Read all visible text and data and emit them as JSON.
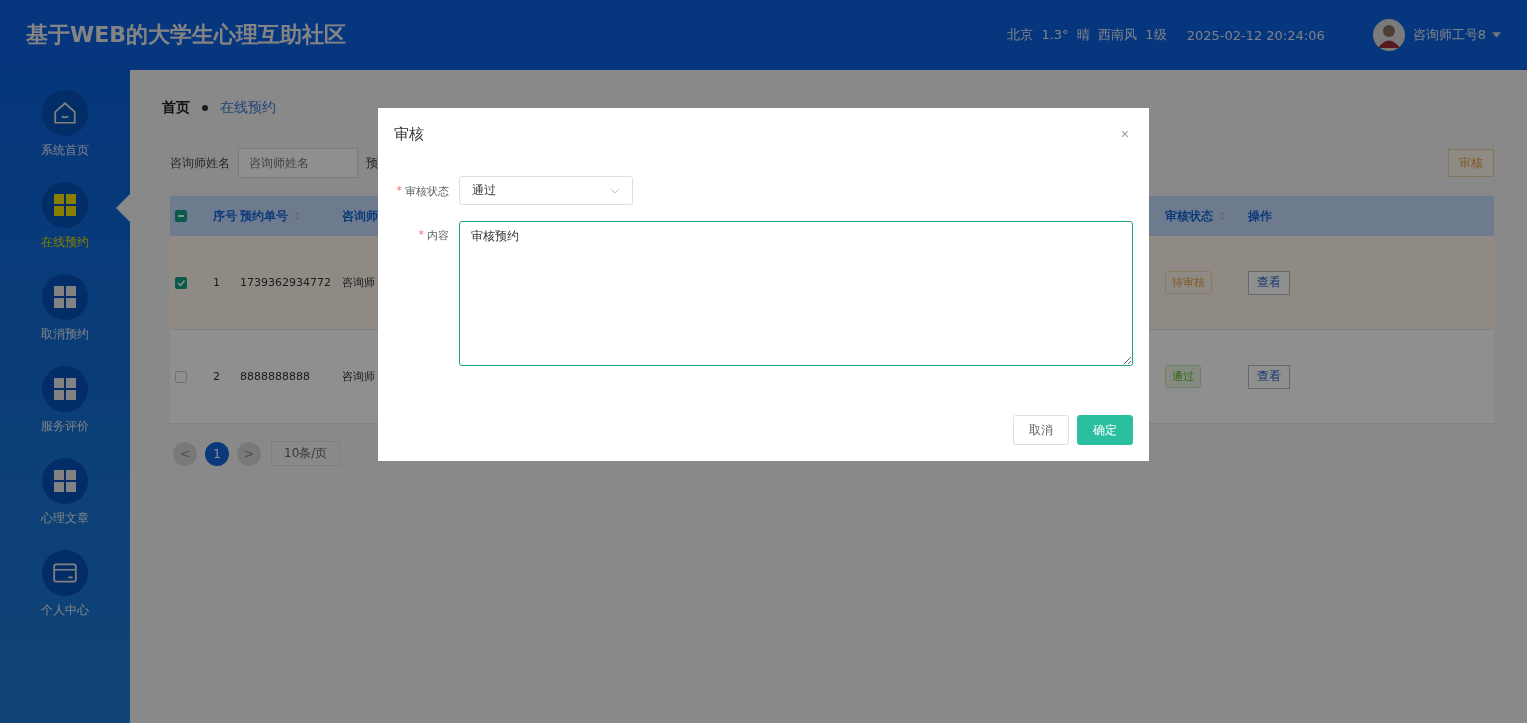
{
  "header": {
    "title": "基于WEB的大学生心理互助社区",
    "weather": "北京  1.3°  晴  西南风  1级",
    "datetime": "2025-02-12 20:24:06",
    "user": "咨询师工号8"
  },
  "sidebar": {
    "items": [
      {
        "label": "系统首页",
        "kind": "home",
        "selected": false
      },
      {
        "label": "在线预约",
        "kind": "grid",
        "selected": true
      },
      {
        "label": "取消预约",
        "kind": "grid",
        "selected": false
      },
      {
        "label": "服务评价",
        "kind": "grid",
        "selected": false
      },
      {
        "label": "心理文章",
        "kind": "grid",
        "selected": false
      },
      {
        "label": "个人中心",
        "kind": "card",
        "selected": false
      }
    ]
  },
  "breadcrumb": [
    {
      "label": "首页",
      "kind": "root"
    },
    {
      "label": "在线预约",
      "kind": "current"
    }
  ],
  "search": {
    "label": "咨询师姓名",
    "placeholder": "咨询师姓名",
    "label_2": "预"
  },
  "actions": [
    {
      "label": "审核"
    }
  ],
  "table": {
    "select_all": {
      "indeterminate": true
    },
    "columns": [
      {
        "label": "序号",
        "sortable": false
      },
      {
        "label": "预约单号",
        "sortable": true
      },
      {
        "label": "咨询师",
        "sortable": false
      },
      {
        "label": "审核状态",
        "sortable": true
      },
      {
        "label": "操作",
        "sortable": false
      }
    ],
    "rows": [
      {
        "checked": true,
        "index": "1",
        "number": "1739362934772",
        "consultant": "咨询师",
        "status": "待审核",
        "kind": "pending",
        "action": "查看"
      },
      {
        "checked": false,
        "index": "2",
        "number": "8888888888",
        "consultant": "咨询师",
        "status": "通过",
        "kind": "passed",
        "action": "查看"
      }
    ]
  },
  "pagination": {
    "prev": "<",
    "pages": [
      {
        "label": "1",
        "selected": true
      }
    ],
    "next": ">",
    "page_size": "10条/页"
  },
  "dialog": {
    "title": "审核",
    "close": "×",
    "fields": [
      {
        "kind": "select",
        "label": "审核状态",
        "required_mark": "*",
        "value": "通过"
      },
      {
        "kind": "textarea",
        "label": "内容",
        "required_mark": "*",
        "value": "审核预约"
      }
    ],
    "buttons": [
      {
        "label": "取消",
        "kind": "default"
      },
      {
        "label": "确定",
        "kind": "primary"
      }
    ]
  }
}
